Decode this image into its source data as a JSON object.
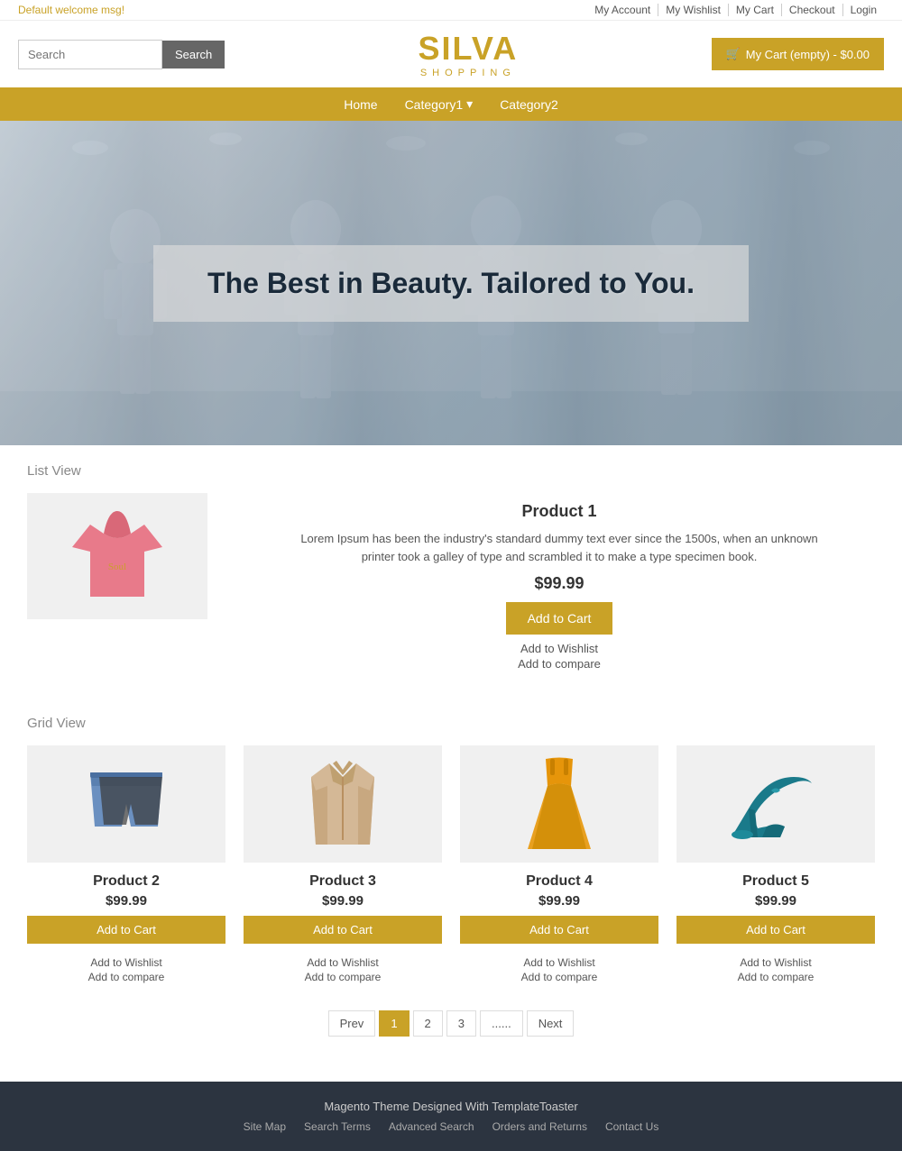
{
  "topbar": {
    "welcome": "Default welcome msg!",
    "links": [
      "My Account",
      "My Wishlist",
      "My Cart",
      "Checkout",
      "Login"
    ]
  },
  "header": {
    "search_placeholder": "Search",
    "search_button": "Search",
    "logo_main": "SIL",
    "logo_accent": "VA",
    "logo_sub": "SHOPPING",
    "cart_button": "My Cart (empty) - $0.00"
  },
  "nav": {
    "items": [
      {
        "label": "Home",
        "has_dropdown": false
      },
      {
        "label": "Category1",
        "has_dropdown": true
      },
      {
        "label": "Category2",
        "has_dropdown": false
      }
    ]
  },
  "hero": {
    "text": "The Best in Beauty. Tailored to You."
  },
  "list_view": {
    "title": "List View",
    "product": {
      "name": "Product 1",
      "description": "Lorem Ipsum has been the industry's standard dummy text ever since the 1500s, when an unknown printer took a galley of type and scrambled it to make a type specimen book.",
      "price": "$99.99",
      "add_to_cart": "Add to Cart",
      "wishlist": "Add to Wishlist",
      "compare": "Add to compare"
    }
  },
  "grid_view": {
    "title": "Grid View",
    "products": [
      {
        "name": "Product 2",
        "price": "$99.99",
        "add_to_cart": "Add to Cart",
        "wishlist": "Add to Wishlist",
        "compare": "Add to compare",
        "color": "#e8edf2"
      },
      {
        "name": "Product 3",
        "price": "$99.99",
        "add_to_cart": "Add to Cart",
        "wishlist": "Add to Wishlist",
        "compare": "Add to compare",
        "color": "#f0ece8"
      },
      {
        "name": "Product 4",
        "price": "$99.99",
        "add_to_cart": "Add to Cart",
        "wishlist": "Add to Wishlist",
        "compare": "Add to compare",
        "color": "#f5ede0"
      },
      {
        "name": "Product 5",
        "price": "$99.99",
        "add_to_cart": "Add to Cart",
        "wishlist": "Add to Wishlist",
        "compare": "Add to compare",
        "color": "#e0edf0"
      }
    ]
  },
  "pagination": {
    "prev": "Prev",
    "next": "Next",
    "pages": [
      "1",
      "2",
      "3",
      "......"
    ],
    "active": "1"
  },
  "footer": {
    "credit": "Magento Theme Designed With TemplateToaster",
    "links": [
      "Site Map",
      "Search Terms",
      "Advanced Search",
      "Orders and Returns",
      "Contact Us"
    ]
  }
}
